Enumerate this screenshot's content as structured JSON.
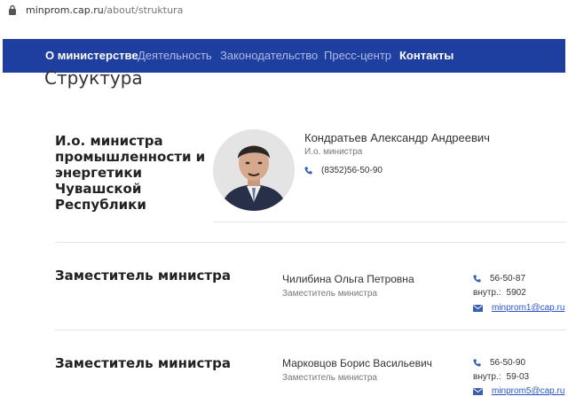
{
  "browser": {
    "url_domain": "minprom.cap.ru",
    "url_path": "/about/struktura",
    "url_prefix": "minprom."
  },
  "nav": {
    "items": [
      "О министерстве",
      "Деятельность",
      "Законодательство",
      "Пресс-центр",
      "Контакты"
    ]
  },
  "page": {
    "title": "Структура"
  },
  "sections": [
    {
      "title": "И.о. министра промышленности и энергетики Чувашской Республики",
      "title_lines": [
        "И.о. министра",
        "промышленности и",
        "энергетики Чувашской",
        "Республики"
      ],
      "person": {
        "name": "Кондратьев Александр Андреевич",
        "role": "И.о. министра",
        "phone": "(8352)56-50-90"
      }
    },
    {
      "title": "Заместитель министра",
      "person": {
        "name": "Чилибина Ольга Петровна",
        "role": "Заместитель министра",
        "phone": "56-50-87",
        "ext_label": "внутр.:",
        "ext": "5902",
        "email": "minprom1@cap.ru"
      }
    },
    {
      "title": "Заместитель министра",
      "person": {
        "name": "Марковцов Борис Васильевич",
        "role": "Заместитель министра",
        "phone": "56-50-90",
        "ext_label": "внутр.:",
        "ext": "59-03",
        "email": "minprom5@cap.ru"
      }
    }
  ],
  "icons": {
    "lock": "lock-icon",
    "phone": "phone-icon",
    "mail": "mail-icon"
  },
  "colors": {
    "nav_bg": "#1f3fa0",
    "nav_inactive": "#aebbe2",
    "link": "#2a56c6",
    "icon": "#3a5fb0"
  }
}
